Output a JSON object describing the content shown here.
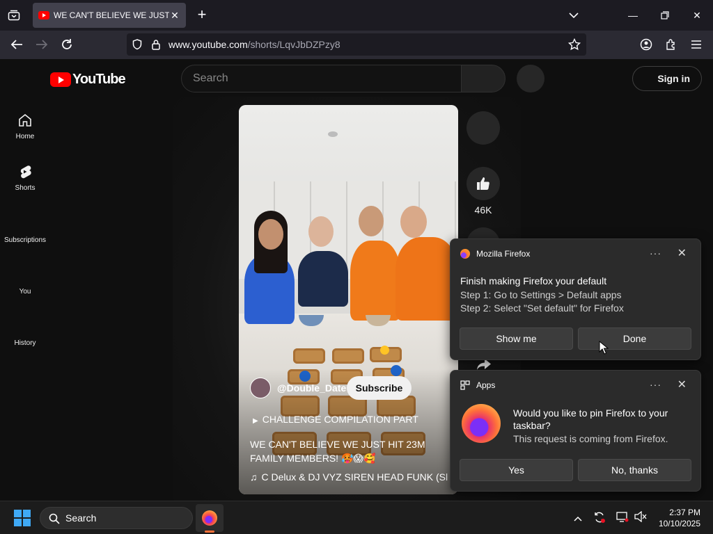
{
  "browser": {
    "tab_title": "WE CAN'T BELIEVE WE JUST HIT",
    "url_host": "www.youtube.com",
    "url_path": "/shorts/LqvJbDZPzy8"
  },
  "youtube": {
    "logo_text": "YouTube",
    "search_placeholder": "Search",
    "sign_in": "Sign in",
    "sidebar": [
      {
        "label": "Home"
      },
      {
        "label": "Shorts"
      },
      {
        "label": "Subscriptions"
      },
      {
        "label": "You"
      },
      {
        "label": "History"
      }
    ],
    "short": {
      "channel": "@Double_Date",
      "subscribe": "Subscribe",
      "playlist": "CHALLENGE COMPILATION PART",
      "title": "WE CAN'T BELIEVE WE JUST HIT 23M FAMILY MEMBERS! 🥵😱🥰",
      "music": "C Delux & DJ VYZ     SIREN HEAD FUNK (Sl",
      "likes": "46K"
    }
  },
  "notifications": {
    "default_browser": {
      "app": "Mozilla Firefox",
      "heading": "Finish making Firefox your default",
      "step1": "Step 1: Go to Settings > Default apps",
      "step2": "Step 2: Select \"Set default\" for Firefox",
      "btn_show": "Show me",
      "btn_done": "Done"
    },
    "pin_taskbar": {
      "app": "Apps",
      "question": "Would you like to pin Firefox to your taskbar?",
      "sub": "This request is coming from Firefox.",
      "btn_yes": "Yes",
      "btn_no": "No, thanks"
    },
    "more_glyph": "···",
    "close_glyph": "✕"
  },
  "taskbar": {
    "search_label": "Search",
    "time": "2:37 PM",
    "date": "10/10/2025"
  },
  "colors": {
    "yt_red": "#ff0000",
    "firefox_orange": "#ff7139",
    "windows_blue": "#3fa9f5"
  }
}
